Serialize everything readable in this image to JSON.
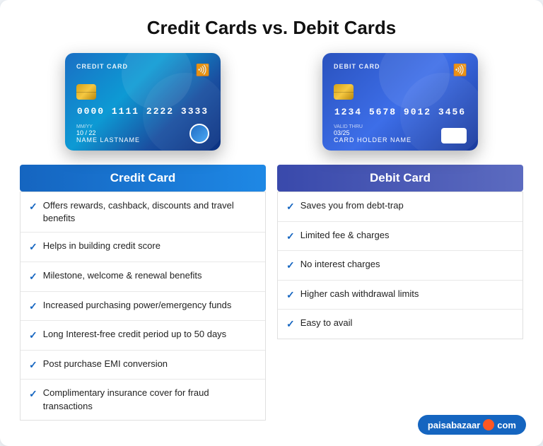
{
  "page": {
    "title": "Credit Cards vs. Debit Cards",
    "background_color": "#f0f4f8"
  },
  "credit_column": {
    "card": {
      "type_label": "CREDIT CARD",
      "number": "0000  1111  2222  3333",
      "expiry_label": "MM/YY",
      "expiry_value": "10 / 22",
      "name": "NAME LASTNAME"
    },
    "header": "Credit Card",
    "features": [
      "Offers rewards, cashback, discounts and travel benefits",
      "Helps in building credit score",
      "Milestone, welcome & renewal benefits",
      "Increased purchasing power/emergency funds",
      "Long Interest-free credit period up to 50 days",
      "Post purchase EMI conversion",
      "Complimentary insurance cover for fraud transactions"
    ]
  },
  "debit_column": {
    "card": {
      "type_label": "DEBIT CARD",
      "number": "1234  5678  9012  3456",
      "expiry_label": "VALID THRU",
      "expiry_value": "03/25",
      "name": "CARD HOLDER NAME"
    },
    "header": "Debit Card",
    "features": [
      "Saves you from debt-trap",
      "Limited fee & charges",
      "No interest charges",
      "Higher cash withdrawal limits",
      "Easy to avail"
    ]
  },
  "watermark": {
    "text": "paisabazaar",
    "suffix": ".com"
  }
}
